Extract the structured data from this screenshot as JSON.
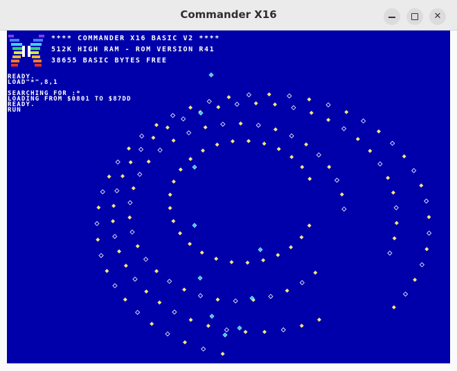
{
  "window": {
    "title": "Commander X16",
    "controls": {
      "minimize_icon": "minimize-icon",
      "maximize_icon": "maximize-icon",
      "close_icon": "close-icon",
      "close_glyph": "✕"
    }
  },
  "terminal": {
    "header_lines": [
      "**** COMMANDER X16 BASIC V2 ****",
      "512K HIGH RAM - ROM VERSION R41",
      "38655 BASIC BYTES FREE"
    ],
    "output_lines": [
      "READY.",
      "LOAD\"*\",8,1",
      "SEARCHING FOR :*",
      "LOADING FROM $0801 TO $87DD",
      "READY.",
      "RUN"
    ],
    "colors": {
      "background": "#0000aa",
      "text": "#ffffff",
      "dot_yellow": "#f5e37a",
      "dot_cyan": "#3fc4d8",
      "dot_outline": "#e8e8ff"
    }
  }
}
